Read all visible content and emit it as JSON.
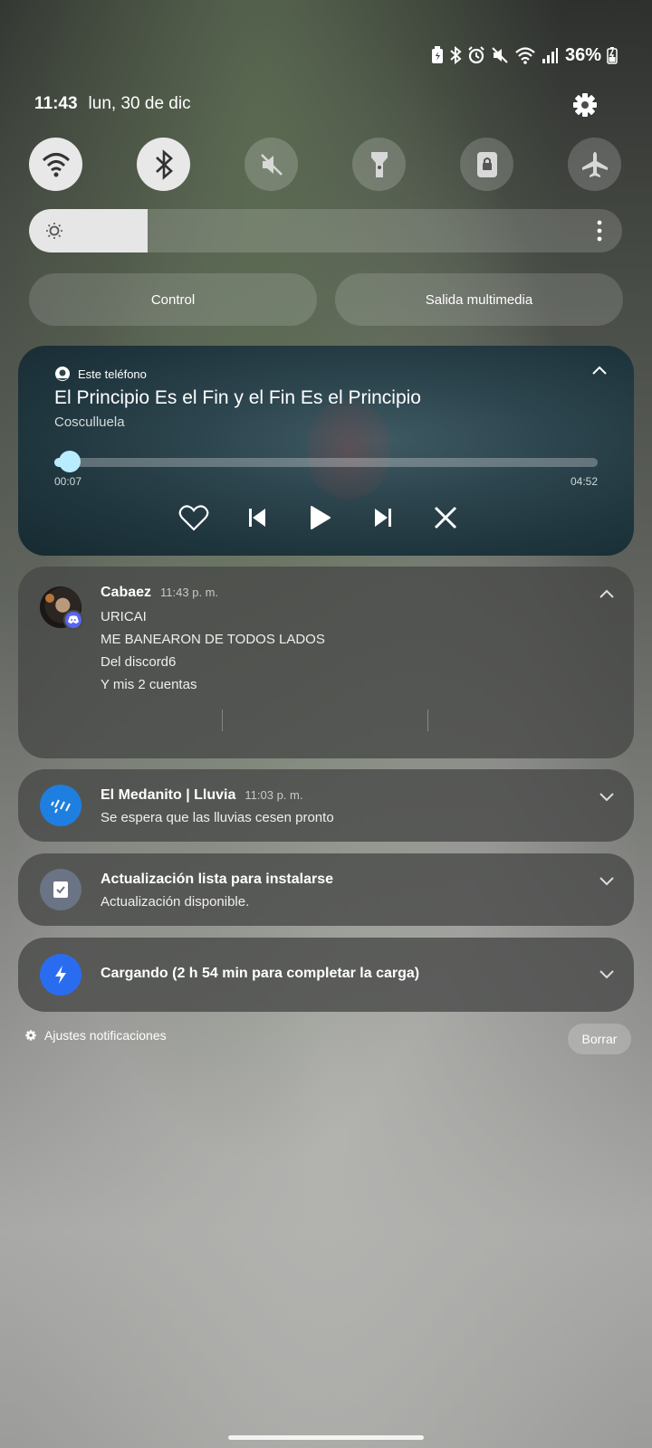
{
  "status_bar": {
    "battery_percent": "36%",
    "icons": [
      "battery-saver-icon",
      "bluetooth-icon",
      "alarm-icon",
      "mute-icon",
      "wifi-icon",
      "signal-icon",
      "battery-charging-icon"
    ]
  },
  "header": {
    "time": "11:43",
    "date": "lun, 30 de dic"
  },
  "quick_toggles": [
    {
      "name": "wifi",
      "state": "on"
    },
    {
      "name": "bluetooth",
      "state": "on"
    },
    {
      "name": "mute",
      "state": "off"
    },
    {
      "name": "flashlight",
      "state": "off"
    },
    {
      "name": "rotation-lock",
      "state": "off"
    },
    {
      "name": "airplane-mode",
      "state": "off"
    }
  ],
  "brightness": {
    "level": 0.2
  },
  "buttons": {
    "control": "Control",
    "media_output": "Salida multimedia"
  },
  "media": {
    "source": "Este teléfono",
    "title": "El Principio Es el Fin y el Fin Es el Principio",
    "artist": "Cosculluela",
    "elapsed": "00:07",
    "duration": "04:52",
    "progress": 0.024,
    "accent": "#b9ecff"
  },
  "notifications": [
    {
      "app": "Cabaez",
      "time": "11:43 p. m.",
      "lines": [
        "URICAI",
        "ME BANEARON DE TODOS LADOS",
        "Del discord6",
        "Y mis 2 cuentas"
      ]
    },
    {
      "app": "El Medanito | Lluvia",
      "time": "11:03 p. m.",
      "lines": [
        "Se espera que las lluvias cesen pronto"
      ],
      "icon_color": "#1f7fe0"
    },
    {
      "app": "Actualización lista para instalarse",
      "lines": [
        "Actualización disponible."
      ],
      "icon_color": "#6b7484"
    },
    {
      "app": "Cargando (2 h 54 min para completar la carga)",
      "icon_color": "#2a6cf0"
    }
  ],
  "footer": {
    "notif_settings": "Ajustes notificaciones",
    "clear": "Borrar"
  }
}
